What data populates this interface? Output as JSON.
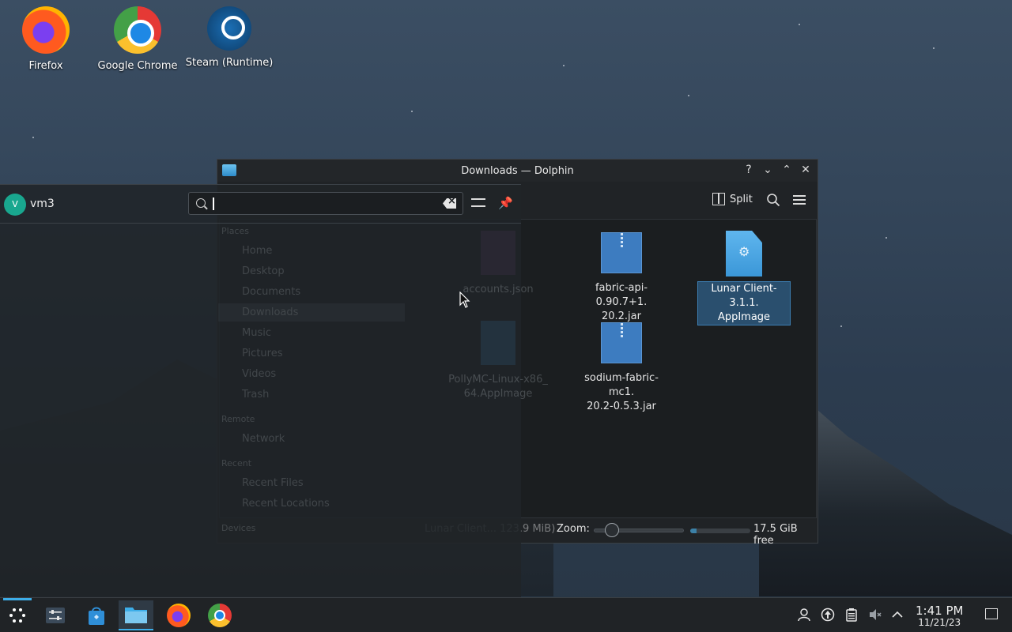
{
  "desktop": {
    "icons": [
      {
        "label": "Firefox"
      },
      {
        "label": "Google Chrome"
      },
      {
        "label": "Steam (Runtime)"
      }
    ]
  },
  "dolphin": {
    "title": "Downloads — Dolphin",
    "titlebar_buttons": [
      "?",
      "⌄",
      "⌃",
      "✕"
    ],
    "toolbar": {
      "split_label": "Split"
    },
    "files": [
      {
        "name": "accounts.json",
        "type": "json",
        "ghosted": true
      },
      {
        "name": "fabric-api-0.90.7+1.20.2.jar",
        "line1": "fabric-api-0.90.7+1.",
        "line2": "20.2.jar",
        "type": "zip"
      },
      {
        "name": "Lunar Client-3.1.1.AppImage",
        "line1": "Lunar Client-3.1.1.",
        "line2": "AppImage",
        "type": "app",
        "selected": true
      },
      {
        "name": "PollyMC-Linux-x86_64.AppImage",
        "line1": "PollyMC-Linux-x86_",
        "line2": "64.AppImage",
        "type": "app",
        "ghosted": true
      },
      {
        "name": "sodium-fabric-mc1.20.2-0.5.3.jar",
        "line1": "sodium-fabric-mc1.",
        "line2": "20.2-0.5.3.jar",
        "type": "zip"
      }
    ],
    "places": {
      "header_places": "Places",
      "items": [
        "Home",
        "Desktop",
        "Documents",
        "Downloads",
        "Music",
        "Pictures",
        "Videos",
        "Trash"
      ],
      "header_remote": "Remote",
      "remote_items": [
        "Network"
      ],
      "header_recent": "Recent",
      "recent_items": [
        "Recent Files",
        "Recent Locations"
      ],
      "header_devices": "Devices"
    },
    "status": {
      "selection": "Lunar Client... 123.9 MiB)",
      "zoom_label": "Zoom:",
      "zoom_level": 0.2,
      "free_space": "17.5 GiB free",
      "free_fraction": 0.1
    }
  },
  "launcher": {
    "user_initial": "V",
    "user_name": "vm3",
    "search_value": ""
  },
  "taskbar": {
    "items": [
      "application-launcher",
      "system-settings",
      "discover",
      "dolphin",
      "firefox",
      "chrome"
    ],
    "active": "dolphin",
    "clock_time": "1:41 PM",
    "clock_date": "11/21/23"
  },
  "colors": {
    "accent": "#3daee9",
    "window_bg": "#202326",
    "selection_bg": "#2a4f6e"
  }
}
